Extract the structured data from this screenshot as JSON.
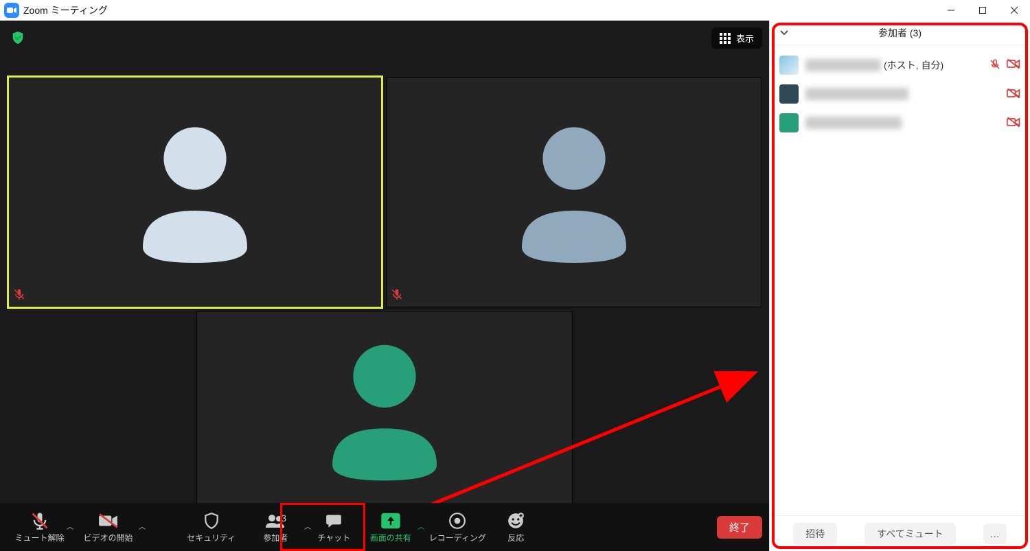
{
  "window": {
    "title": "Zoom ミーティング"
  },
  "video": {
    "view_label": "表示"
  },
  "toolbar": {
    "mute_label": "ミュート解除",
    "video_label": "ビデオの開始",
    "security_label": "セキュリティ",
    "participants_label": "参加者",
    "participants_count": "3",
    "chat_label": "チャット",
    "share_label": "画面の共有",
    "record_label": "レコーディング",
    "reaction_label": "反応",
    "end_label": "終了"
  },
  "panel": {
    "title": "参加者 (3)",
    "participants": [
      {
        "name": "████████",
        "suffix": "(ホスト, 自分)",
        "mic_muted": true,
        "cam_off": true,
        "avatar_color": "gradient"
      },
      {
        "name": "██████████████",
        "suffix": "",
        "mic_muted": false,
        "cam_off": true,
        "avatar_color": "#2f4858"
      },
      {
        "name": "████████████",
        "suffix": "",
        "mic_muted": false,
        "cam_off": true,
        "avatar_color": "#27a07a"
      }
    ],
    "invite_label": "招待",
    "mute_all_label": "すべてミュート",
    "more_label": "…"
  },
  "colors": {
    "avatar1": "#d4dfec",
    "avatar2": "#90a9bd",
    "avatar3": "#27a07a",
    "red": "#d93a3a",
    "green": "#27c26c"
  }
}
